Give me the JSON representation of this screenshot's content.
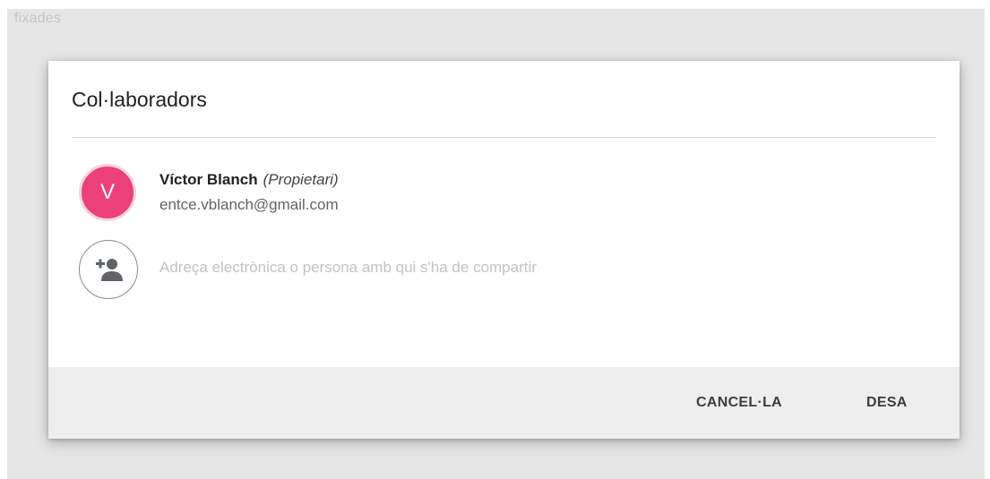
{
  "background": {
    "label": "fixades"
  },
  "dialog": {
    "title": "Col·laboradors",
    "owner": {
      "initial": "V",
      "name": "Víctor Blanch",
      "role": "(Propietari)",
      "email": "entce.vblanch@gmail.com",
      "avatar_color": "#ec407a"
    },
    "share": {
      "placeholder": "Adreça electrònica o persona amb qui s'ha de compartir",
      "icon": "add-person-icon"
    },
    "footer": {
      "cancel_label": "CANCEL·LA",
      "save_label": "DESA"
    }
  }
}
